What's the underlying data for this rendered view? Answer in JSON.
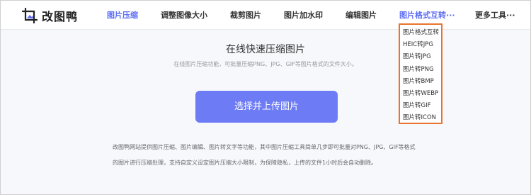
{
  "logo": {
    "icon": "crop-image-icon",
    "text": "改图鸭",
    "accent_color": "#5b6cf6"
  },
  "nav": [
    {
      "label": "图片压缩",
      "active": true
    },
    {
      "label": "调整图像大小",
      "active": false
    },
    {
      "label": "裁剪图片",
      "active": false
    },
    {
      "label": "图片加水印",
      "active": false
    },
    {
      "label": "编辑图片",
      "active": false
    },
    {
      "label": "图片格式互转···",
      "active": true
    },
    {
      "label": "更多工具···",
      "active": false
    }
  ],
  "dropdown": {
    "border_color": "#e8742e",
    "items": [
      "图片格式互转",
      "HEIC转JPG",
      "图片转JPG",
      "图片转PNG",
      "图片转BMP",
      "图片转WEBP",
      "图片转GIF",
      "图片转ICON"
    ]
  },
  "main": {
    "title": "在线快速压缩图片",
    "subtitle": "在线图片压缩功能，可批量压缩PNG、JPG、GIF等图片格式的文件大小。",
    "upload_button": "选择并上传图片",
    "button_color": "#6d7cf5",
    "description": [
      "改图鸭网站提供图片压缩、图片编辑、图片转文字等功能，其中图片压缩工具简单几步即可批量对PNG、JPG、GIF等格式",
      "的图片进行压缩处理，支持自定义设定图片压缩大小限制，为保障隐私，上传的文件1小时后会自动删除。"
    ]
  }
}
